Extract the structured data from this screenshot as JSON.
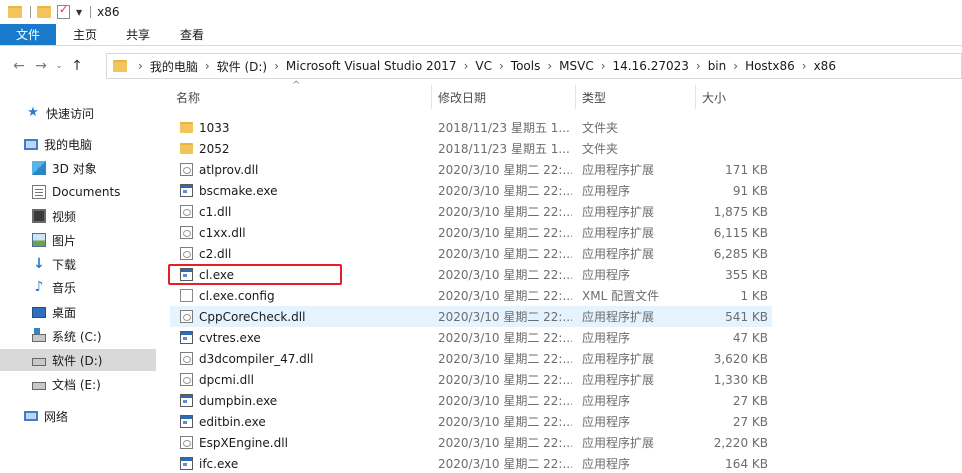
{
  "window": {
    "title": "x86"
  },
  "ribbon": {
    "tabs": [
      "文件",
      "主页",
      "共享",
      "查看"
    ]
  },
  "nav": {
    "back": "←",
    "forward": "→",
    "recent": "⌄",
    "up": "↑"
  },
  "breadcrumb": [
    "我的电脑",
    "软件 (D:)",
    "Microsoft Visual Studio 2017",
    "VC",
    "Tools",
    "MSVC",
    "14.16.27023",
    "bin",
    "Hostx86",
    "x86"
  ],
  "sidebar": {
    "items": [
      {
        "label": "快速访问",
        "icon": "star-icon"
      },
      {
        "label": "我的电脑",
        "icon": "computer-icon"
      },
      {
        "label": "3D 对象",
        "icon": "3d-objects-icon"
      },
      {
        "label": "Documents",
        "icon": "documents-icon"
      },
      {
        "label": "视频",
        "icon": "video-icon"
      },
      {
        "label": "图片",
        "icon": "pictures-icon"
      },
      {
        "label": "下载",
        "icon": "download-icon"
      },
      {
        "label": "音乐",
        "icon": "music-icon"
      },
      {
        "label": "桌面",
        "icon": "desktop-icon"
      },
      {
        "label": "系统 (C:)",
        "icon": "drive-icon"
      },
      {
        "label": "软件 (D:)",
        "icon": "drive-icon"
      },
      {
        "label": "文档 (E:)",
        "icon": "drive-icon"
      },
      {
        "label": "网络",
        "icon": "network-icon"
      }
    ],
    "selected_index": 10
  },
  "columns": {
    "name": "名称",
    "date": "修改日期",
    "type": "类型",
    "size": "大小"
  },
  "files": [
    {
      "name": "1033",
      "date": "2018/11/23 星期五 1...",
      "type": "文件夹",
      "size": "",
      "icon": "folder"
    },
    {
      "name": "2052",
      "date": "2018/11/23 星期五 1...",
      "type": "文件夹",
      "size": "",
      "icon": "folder"
    },
    {
      "name": "atlprov.dll",
      "date": "2020/3/10 星期二 22:...",
      "type": "应用程序扩展",
      "size": "171 KB",
      "icon": "dll"
    },
    {
      "name": "bscmake.exe",
      "date": "2020/3/10 星期二 22:...",
      "type": "应用程序",
      "size": "91 KB",
      "icon": "exe"
    },
    {
      "name": "c1.dll",
      "date": "2020/3/10 星期二 22:...",
      "type": "应用程序扩展",
      "size": "1,875 KB",
      "icon": "dll"
    },
    {
      "name": "c1xx.dll",
      "date": "2020/3/10 星期二 22:...",
      "type": "应用程序扩展",
      "size": "6,115 KB",
      "icon": "dll"
    },
    {
      "name": "c2.dll",
      "date": "2020/3/10 星期二 22:...",
      "type": "应用程序扩展",
      "size": "6,285 KB",
      "icon": "dll"
    },
    {
      "name": "cl.exe",
      "date": "2020/3/10 星期二 22:...",
      "type": "应用程序",
      "size": "355 KB",
      "icon": "exe"
    },
    {
      "name": "cl.exe.config",
      "date": "2020/3/10 星期二 22:...",
      "type": "XML 配置文件",
      "size": "1 KB",
      "icon": "cfg"
    },
    {
      "name": "CppCoreCheck.dll",
      "date": "2020/3/10 星期二 22:...",
      "type": "应用程序扩展",
      "size": "541 KB",
      "icon": "dll"
    },
    {
      "name": "cvtres.exe",
      "date": "2020/3/10 星期二 22:...",
      "type": "应用程序",
      "size": "47 KB",
      "icon": "exe"
    },
    {
      "name": "d3dcompiler_47.dll",
      "date": "2020/3/10 星期二 22:...",
      "type": "应用程序扩展",
      "size": "3,620 KB",
      "icon": "dll"
    },
    {
      "name": "dpcmi.dll",
      "date": "2020/3/10 星期二 22:...",
      "type": "应用程序扩展",
      "size": "1,330 KB",
      "icon": "dll"
    },
    {
      "name": "dumpbin.exe",
      "date": "2020/3/10 星期二 22:...",
      "type": "应用程序",
      "size": "27 KB",
      "icon": "exe"
    },
    {
      "name": "editbin.exe",
      "date": "2020/3/10 星期二 22:...",
      "type": "应用程序",
      "size": "27 KB",
      "icon": "exe"
    },
    {
      "name": "EspXEngine.dll",
      "date": "2020/3/10 星期二 22:...",
      "type": "应用程序扩展",
      "size": "2,220 KB",
      "icon": "dll"
    },
    {
      "name": "ifc.exe",
      "date": "2020/3/10 星期二 22:...",
      "type": "应用程序",
      "size": "164 KB",
      "icon": "exe"
    }
  ],
  "hover_row_index": 9,
  "highlighted_row_index": 7,
  "colors": {
    "accent": "#1979ca",
    "highlight": "#e2202a",
    "hover": "#e5f3ff",
    "selected": "#d9d9d9"
  }
}
